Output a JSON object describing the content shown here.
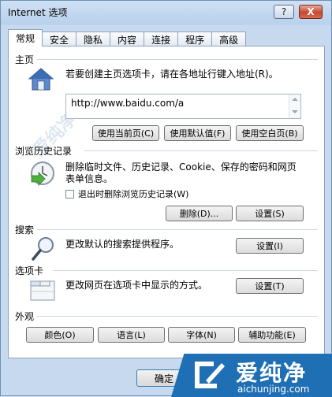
{
  "window": {
    "title": "Internet 选项",
    "help_btn": "?",
    "close_btn": "X"
  },
  "tabs": [
    "常规",
    "安全",
    "隐私",
    "内容",
    "连接",
    "程序",
    "高级"
  ],
  "homepage": {
    "section_title": "主页",
    "description": "若要创建主页选项卡，请在各地址行键入地址(R)。",
    "address": "http://www.baidu.com/a",
    "btn_current": "使用当前页(C)",
    "btn_default": "使用默认值(F)",
    "btn_blank": "使用空白页(B)"
  },
  "history": {
    "section_title": "浏览历史记录",
    "description_line1": "删除临时文件、历史记录、Cookie、保存的密码和网页",
    "description_line2": "表单信息。",
    "checkbox_label": "退出时删除浏览历史记录(W)",
    "checkbox_checked": false,
    "btn_delete": "删除(D)...",
    "btn_settings": "设置(S)"
  },
  "search": {
    "section_title": "搜索",
    "description": "更改默认的搜索提供程序。",
    "btn_settings": "设置(I)"
  },
  "tabsec": {
    "section_title": "选项卡",
    "description": "更改网页在选项卡中显示的方式。",
    "btn_settings": "设置(T)"
  },
  "appearance": {
    "section_title": "外观",
    "btn_colors": "颜色(O)",
    "btn_languages": "语言(L)",
    "btn_fonts": "字体(N)",
    "btn_accessibility": "辅助功能(E)"
  },
  "footer": {
    "btn_ok": "确定"
  },
  "watermark": {
    "brand": "爱纯净",
    "url": "aichunjing.com"
  }
}
